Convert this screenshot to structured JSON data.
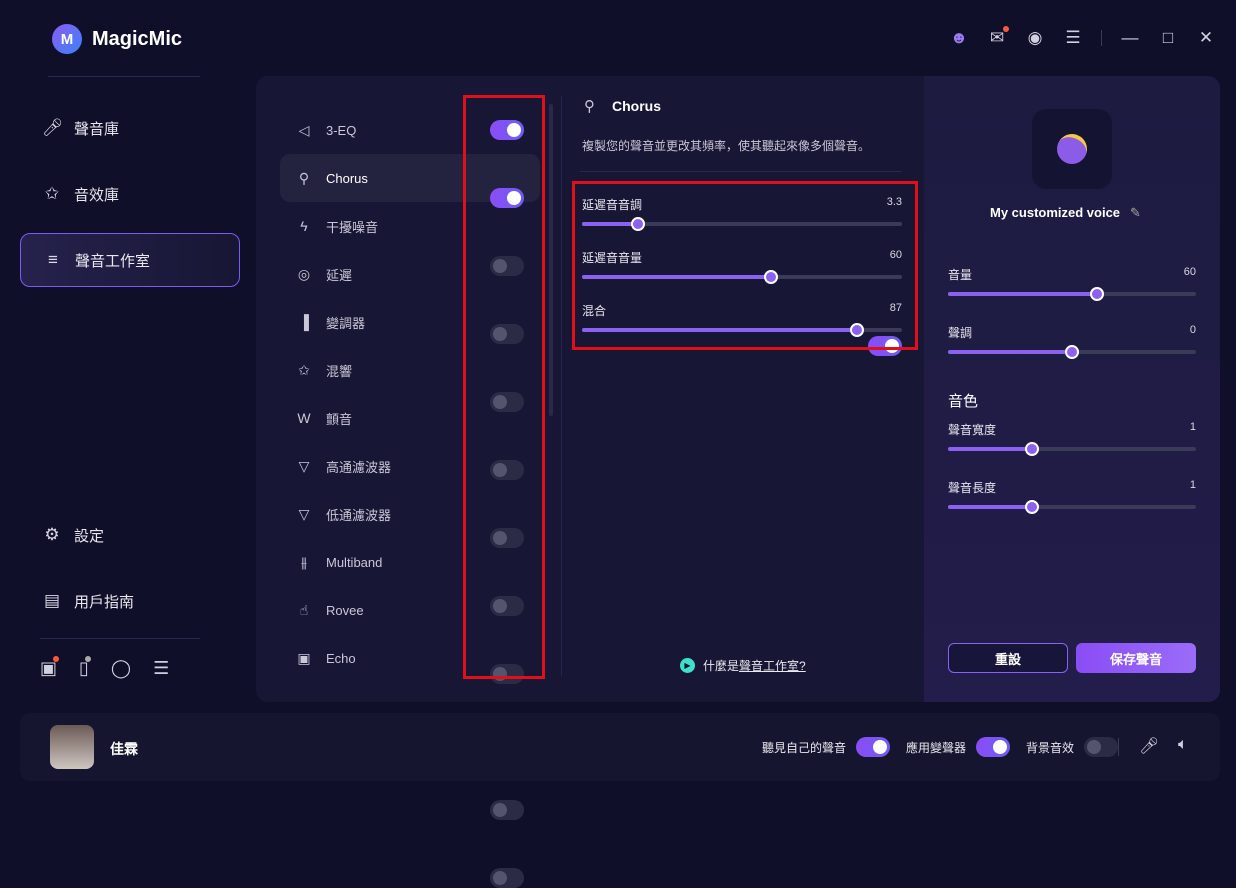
{
  "app": {
    "title": "MagicMic"
  },
  "topbar": {
    "icons": [
      "user-icon",
      "mail-icon",
      "discord-icon",
      "menu-icon",
      "minimize-icon",
      "maximize-icon",
      "close-icon"
    ]
  },
  "sidebar": {
    "items": [
      {
        "label": "聲音庫",
        "icon": "mic-icon"
      },
      {
        "label": "音效庫",
        "icon": "sparkle-icon"
      },
      {
        "label": "聲音工作室",
        "icon": "sliders-icon",
        "active": true
      }
    ],
    "bottom_items": [
      {
        "label": "設定",
        "icon": "gear-icon"
      },
      {
        "label": "用戶指南",
        "icon": "book-icon"
      }
    ],
    "tools": [
      "toolbox-icon",
      "phone-icon",
      "chat-icon",
      "filter-icon"
    ]
  },
  "effects": [
    {
      "label": "3-EQ",
      "icon": "speaker-icon",
      "on": true
    },
    {
      "label": "Chorus",
      "icon": "mic-icon",
      "on": true,
      "selected": true
    },
    {
      "label": "干擾噪音",
      "icon": "noise-icon",
      "on": false
    },
    {
      "label": "延遲",
      "icon": "spiral-icon",
      "on": false
    },
    {
      "label": "變調器",
      "icon": "bars-icon",
      "on": false
    },
    {
      "label": "混響",
      "icon": "magic-wand-icon",
      "on": false
    },
    {
      "label": "顫音",
      "icon": "wave-icon",
      "on": false
    },
    {
      "label": "高通濾波器",
      "icon": "highpass-icon",
      "on": false
    },
    {
      "label": "低通濾波器",
      "icon": "lowpass-icon",
      "on": false
    },
    {
      "label": "Multiband",
      "icon": "sliders-icon",
      "on": false
    },
    {
      "label": "Rovee",
      "icon": "hand-icon",
      "on": false
    },
    {
      "label": "Echo",
      "icon": "speaker-box-icon",
      "on": false
    }
  ],
  "detail": {
    "title": "Chorus",
    "enabled": true,
    "description": "複製您的聲音並更改其頻率，使其聽起來像多個聲音。",
    "params": [
      {
        "label": "延遲音音調",
        "value": "3.3",
        "fraction": 0.175
      },
      {
        "label": "延遲音音量",
        "value": "60",
        "fraction": 0.59
      },
      {
        "label": "混合",
        "value": "87",
        "fraction": 0.86
      }
    ],
    "help_prefix": "什麼是",
    "help_link": "聲音工作室?"
  },
  "voice": {
    "name": "My customized voice",
    "sliders": [
      {
        "label": "音量",
        "value": "60",
        "fraction": 0.6
      },
      {
        "label": "聲調",
        "value": "0",
        "fraction": 0.5
      }
    ],
    "timbre_title": "音色",
    "timbre": [
      {
        "label": "聲音寬度",
        "value": "1",
        "fraction": 0.34
      },
      {
        "label": "聲音長度",
        "value": "1",
        "fraction": 0.34
      }
    ],
    "reset": "重設",
    "save": "保存聲音"
  },
  "user": {
    "name": "佳霖"
  },
  "footer": {
    "toggles": [
      {
        "label": "聽見自己的聲音",
        "on": true
      },
      {
        "label": "應用變聲器",
        "on": true
      },
      {
        "label": "背景音效",
        "on": false
      }
    ]
  },
  "colors": {
    "accent": "#8b62f0",
    "highlight": "#e0101a",
    "background": "#100f29"
  }
}
